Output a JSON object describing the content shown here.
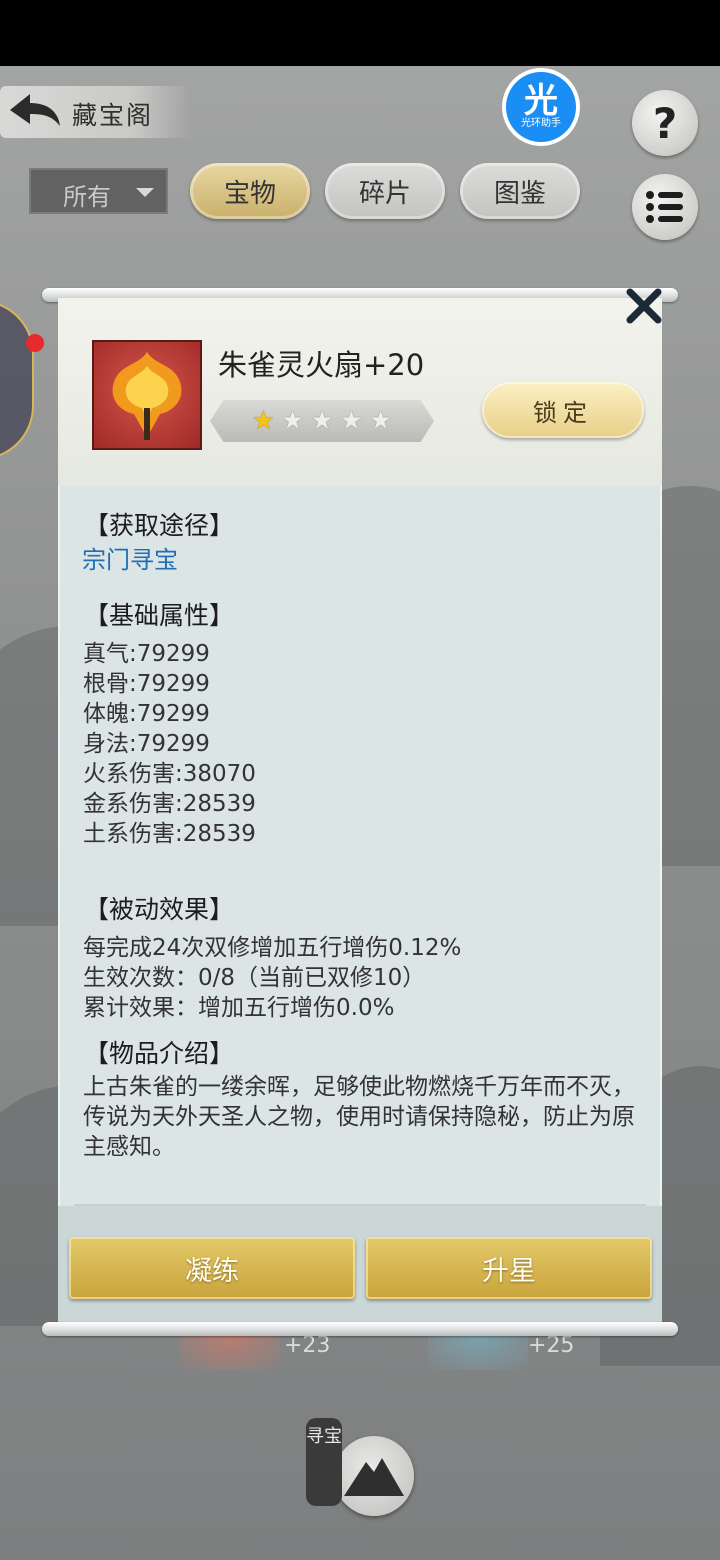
{
  "header": {
    "title": "藏宝阁",
    "badge_big": "光",
    "badge_small": "光环助手",
    "help_label": "?"
  },
  "filter": {
    "selected": "所有",
    "tabs": [
      {
        "label": "宝物",
        "active": true
      },
      {
        "label": "碎片",
        "active": false
      },
      {
        "label": "图鉴",
        "active": false
      }
    ]
  },
  "item": {
    "name": "朱雀灵火扇+20",
    "stars_total": 5,
    "stars_filled": 1,
    "lock_label": "锁定"
  },
  "sections": {
    "source_title": "【获取途径】",
    "source_link": "宗门寻宝",
    "base_title": "【基础属性】",
    "stats": [
      "真气:79299",
      "根骨:79299",
      "体魄:79299",
      "身法:79299",
      "火系伤害:38070",
      "金系伤害:28539",
      "土系伤害:28539"
    ],
    "passive_title": "【被动效果】",
    "passive_lines": [
      "每完成24次双修增加五行增伤0.12%",
      "生效次数：0/8（当前已双修10）",
      "累计效果：增加五行增伤0.0%"
    ],
    "intro_title": "【物品介绍】",
    "intro_text": "上古朱雀的一缕余晖，足够使此物燃烧千万年而不灭，传说为天外天圣人之物，使用时请保持隐秘，防止为原主感知。"
  },
  "actions": {
    "refine": "凝练",
    "star_up": "升星"
  },
  "background": {
    "plus_left": "+23",
    "plus_right": "+25",
    "seek_label": "寻宝"
  },
  "colors": {
    "link": "#1f6fb2",
    "gold_button": "#d6b553",
    "star_on": "#f3c21b",
    "badge_blue": "#1a8ef5"
  }
}
